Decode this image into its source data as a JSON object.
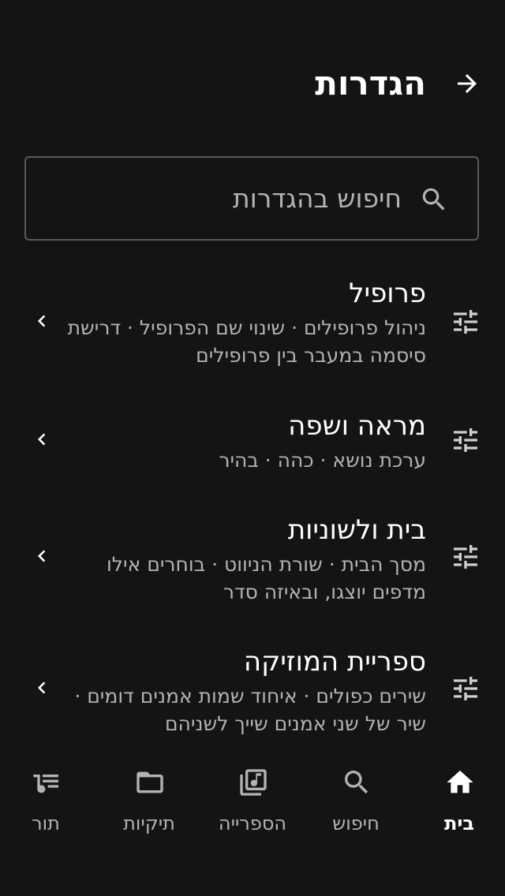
{
  "header": {
    "title": "הגדרות",
    "back_icon": "arrow-forward-icon"
  },
  "search": {
    "placeholder": "חיפוש בהגדרות",
    "icon": "search-icon"
  },
  "settings": [
    {
      "title": "פרופיל",
      "subtitle": "ניהול פרופילים · שינוי שם הפרופיל · דרישת סיסמה במעבר בין פרופילים"
    },
    {
      "title": "מראה ושפה",
      "subtitle": "ערכת נושא · כהה · בהיר"
    },
    {
      "title": "בית ולשוניות",
      "subtitle": "מסך הבית · שורת הניווט · בוחרים אילו מדפים יוצגו, ובאיזה סדר"
    },
    {
      "title": "ספריית המוזיקה",
      "subtitle": "שירים כפולים · איחוד שמות אמנים דומים · שיר של שני אמנים שייך לשניהם"
    }
  ],
  "nav": {
    "home": "בית",
    "search": "חיפוש",
    "library": "הספרייה",
    "folders": "תיקיות",
    "queue": "תור",
    "active": "home"
  },
  "colors": {
    "background": "#141414",
    "text_primary": "#ffffff",
    "text_secondary": "#b3b3b3",
    "icon": "#cfcfcf",
    "border": "#5a5a5a"
  }
}
